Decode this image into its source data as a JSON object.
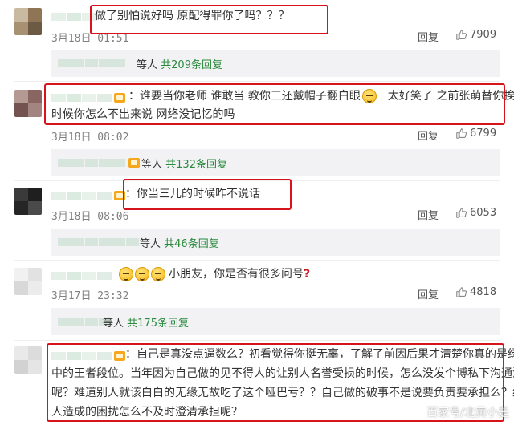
{
  "comments": [
    {
      "text": "做了别怕说好吗 原配得罪你了吗？？？",
      "time": "3月18日 01:51",
      "reply_label": "回复",
      "likes": "7909",
      "sub": {
        "etc": "等人",
        "count": "共209条回复"
      },
      "highlighted": true
    },
    {
      "line1": "：谁要当你老师 谁敢当 教你三还戴帽子翻白眼",
      "line1b": "太好笑了 之前张萌替你挨骂",
      "line2": "时候你怎么不出来说   网络没记忆的吗",
      "time": "3月18日 08:02",
      "reply_label": "回复",
      "likes": "6799",
      "sub": {
        "etc": "等人",
        "count": "共132条回复"
      },
      "highlighted": true
    },
    {
      "text": "：你当三儿的时候咋不说话",
      "time": "3月18日 08:06",
      "reply_label": "回复",
      "likes": "6053",
      "sub": {
        "etc": "等人",
        "count": "共46条回复"
      },
      "highlighted": true
    },
    {
      "text": "小朋友，你是否有很多问号",
      "qmark": "?",
      "time": "3月17日 23:32",
      "reply_label": "回复",
      "likes": "4818",
      "sub": {
        "etc": "等人",
        "count": "共175条回复"
      },
      "highlighted": false
    },
    {
      "line1": "：自己是真没点逼数么？初看觉得你挺无辜，了解了前因后果才清楚你真的是绿茶",
      "line2": "中的王者段位。当年因为自己做的见不得人的让别人名誉受损的时候，怎么没发个博私下沟通沟通",
      "line3": "呢？难道别人就该白白的无缘无故吃了这个哑巴亏？？自己做的破事不是说要负责要承担么？给别",
      "line4": "人造成的困扰怎么不及时澄清承担呢？",
      "highlighted": true
    }
  ],
  "watermark": "百家号/北黄小是",
  "colors": {
    "highlight": "#d7131b",
    "link": "#2a8a3c",
    "subbox": "#f2f2f5",
    "meta": "#808080"
  }
}
